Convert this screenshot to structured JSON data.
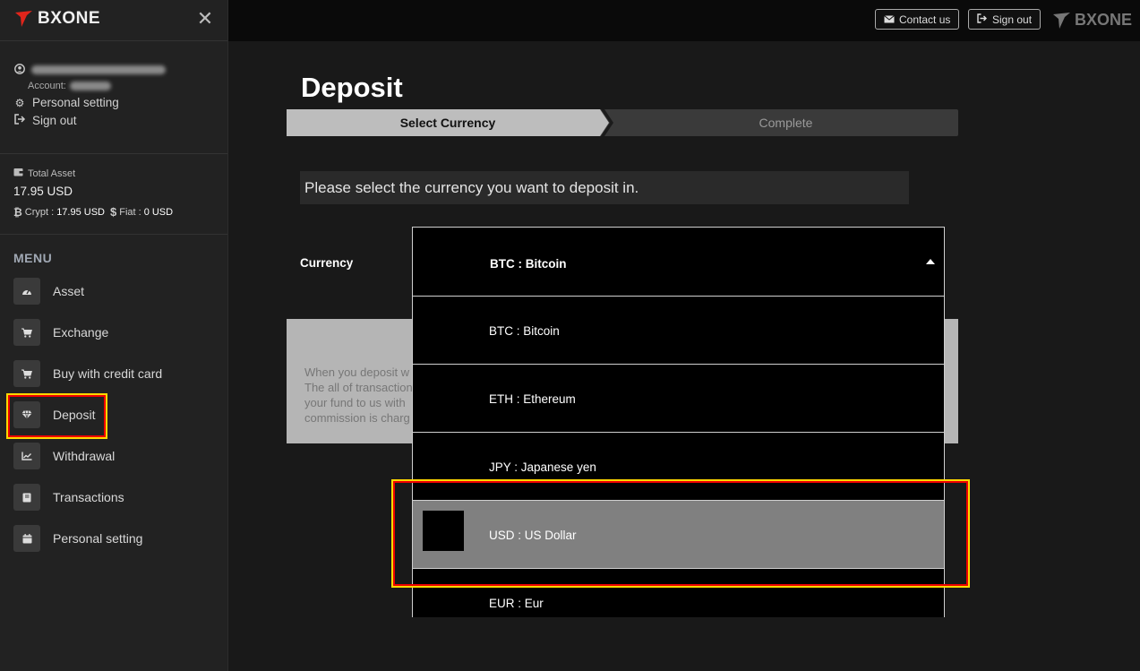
{
  "brand": {
    "name": "BXONE",
    "accent": "#e0251b"
  },
  "sidebar": {
    "user": {
      "email": "",
      "account_label": "Account:",
      "account_id": ""
    },
    "links": [
      {
        "label": "Personal setting",
        "icon": "gear-icon"
      },
      {
        "label": "Sign out",
        "icon": "sign-out-icon"
      }
    ],
    "asset": {
      "title": "Total Asset",
      "value": "17.95 USD",
      "crypt_label": "Crypt :",
      "crypt_value": "17.95 USD",
      "fiat_label": "Fiat :",
      "fiat_value": "0 USD"
    },
    "menu_title": "MENU",
    "menu": [
      {
        "label": "Asset",
        "icon": "dashboard-icon"
      },
      {
        "label": "Exchange",
        "icon": "cart-icon"
      },
      {
        "label": "Buy with credit card",
        "icon": "cart-icon"
      },
      {
        "label": "Deposit",
        "icon": "diamond-icon"
      },
      {
        "label": "Withdrawal",
        "icon": "chart-icon"
      },
      {
        "label": "Transactions",
        "icon": "book-icon"
      },
      {
        "label": "Personal setting",
        "icon": "calendar-icon"
      }
    ]
  },
  "topbar": {
    "contact_label": "Contact us",
    "signout_label": "Sign out"
  },
  "main": {
    "title": "Deposit",
    "steps": [
      {
        "label": "Select Currency",
        "active": true
      },
      {
        "label": "Complete",
        "active": false
      }
    ],
    "instruction": "Please select the currency you want to deposit in.",
    "currency_label": "Currency",
    "selected_value": "BTC : Bitcoin",
    "info_lines": [
      "When you deposit w",
      "The all of transaction",
      "your fund to us with",
      "commission is charg"
    ],
    "options": [
      {
        "label": "BTC : Bitcoin"
      },
      {
        "label": "ETH : Ethereum"
      },
      {
        "label": "JPY : Japanese yen"
      },
      {
        "label": "USD : US Dollar",
        "hover": true
      },
      {
        "label": "EUR : Eur"
      }
    ]
  }
}
